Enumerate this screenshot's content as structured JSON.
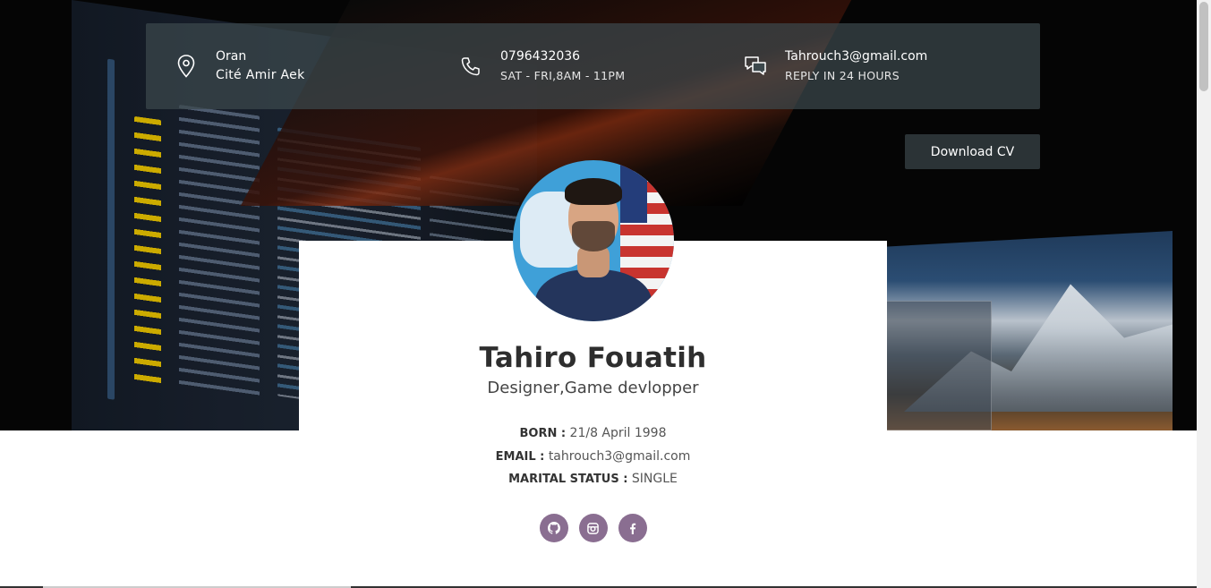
{
  "contact": {
    "address_line1": "Oran",
    "address_line2": "Cité Amir Aek",
    "phone": "0796432036",
    "hours": "SAT - FRI,8AM - 11PM",
    "email": "Tahrouch3@gmail.com",
    "reply": "REPLY IN 24 HOURS"
  },
  "download_label": "Download CV",
  "profile": {
    "name": "Tahiro Fouatih",
    "role": "Designer,Game devlopper",
    "born_label": "BORN :",
    "born_value": "21/8 April 1998",
    "email_label": "EMAIL :",
    "email_value": "tahrouch3@gmail.com",
    "marital_label": "MARITAL STATUS :",
    "marital_value": "SINGLE"
  },
  "socials": [
    {
      "icon": "github-icon",
      "glyph": "⌘"
    },
    {
      "icon": "instagram-icon",
      "glyph": "◙"
    },
    {
      "icon": "facebook-icon",
      "glyph": "f"
    }
  ],
  "colors": {
    "social_bg": "#8a6e91",
    "info_bar": "#3c484c",
    "button": "#2b3336"
  }
}
